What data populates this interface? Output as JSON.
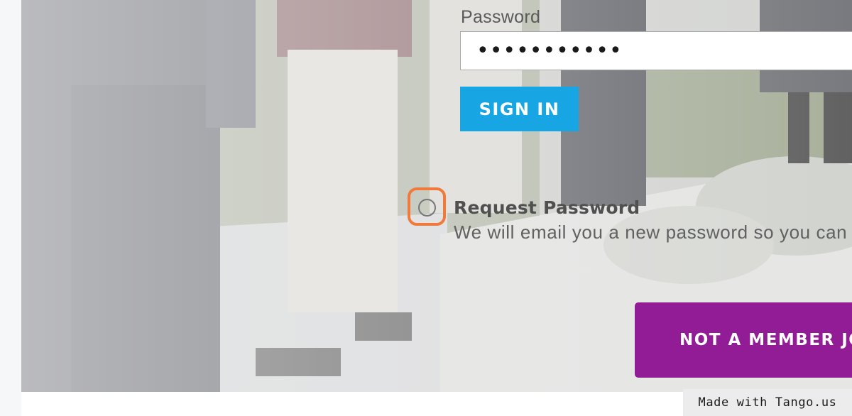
{
  "login": {
    "password_label": "Password",
    "password_value": "•••••••••••",
    "sign_in_label": "SIGN IN"
  },
  "request_password": {
    "title": "Request Password",
    "description": "We will email you a new password so you can log in"
  },
  "join": {
    "label": "NOT A MEMBER JOIN"
  },
  "watermark": {
    "text": "Made with Tango.us"
  },
  "colors": {
    "sign_in": "#18a5e3",
    "join": "#921b96",
    "highlight": "#f07a3c"
  }
}
